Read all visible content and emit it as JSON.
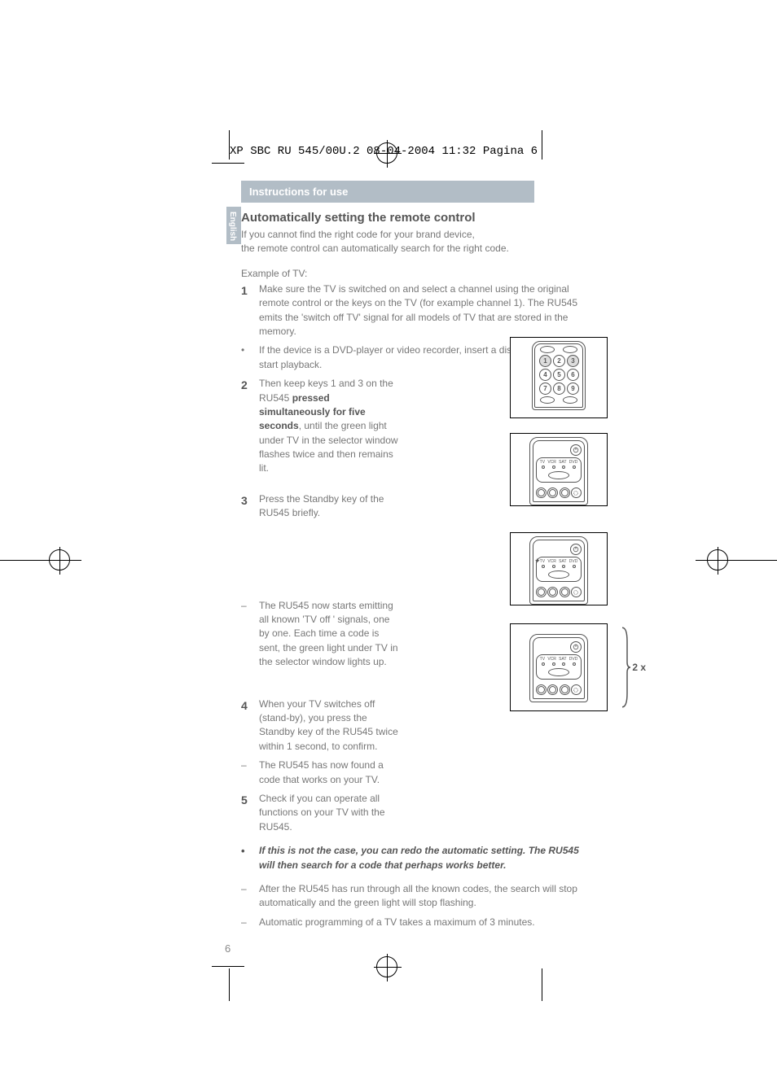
{
  "header_note": "XP SBC RU 545/00U.2  08-04-2004  11:32  Pagina 6",
  "band": "Instructions for use",
  "lang_tab": "English",
  "title": "Automatically setting the remote control",
  "intro_l1": "If you cannot find the right code for your brand device,",
  "intro_l2": "the remote control can automatically search for the right code.",
  "example": "Example of TV:",
  "step1": {
    "num": "1",
    "text": "Make sure the TV is switched on and select a channel using the original remote control or the keys on the TV (for example channel 1). The RU545 emits the 'switch off TV' signal for all models of TV that are stored in the memory."
  },
  "step1b": "If the device is a DVD-player or video recorder, insert a disk or tape and start playback.",
  "step2": {
    "num": "2",
    "pre": "Then keep keys 1 and 3 on the RU545 ",
    "bold": "pressed simultaneously for five seconds",
    "post": ", until the green light under TV in the selector window flashes twice and then remains lit."
  },
  "step3": {
    "num": "3",
    "text": "Press the Standby key of the RU545 briefly."
  },
  "step3b": "The RU545 now starts emitting all known 'TV off ' signals, one by one. Each time a code is sent, the green light under TV in the selector window lights up.",
  "step4": {
    "num": "4",
    "text": "When your TV switches off (stand-by), you press the Standby key of the RU545 twice within 1 second, to confirm."
  },
  "step4b": "The RU545 has now found a code that works on your TV.",
  "step5": {
    "num": "5",
    "text": "Check if you can operate all functions on your TV with the RU545."
  },
  "note": "If this is not the case, you can redo the automatic setting. The RU545 will then search for a code that perhaps works better.",
  "aft1": "After the RU545 has run through all the known codes, the search will stop automatically and the green light will stop flashing.",
  "aft2": "Automatic programming of a TV takes a maximum of 3 minutes.",
  "page_num": "6",
  "keys": [
    "1",
    "2",
    "3",
    "4",
    "5",
    "6",
    "7",
    "8",
    "9"
  ],
  "sel_labels": [
    "TV",
    "VCR",
    "SAT",
    "DVD"
  ],
  "brace_label": "2 x"
}
